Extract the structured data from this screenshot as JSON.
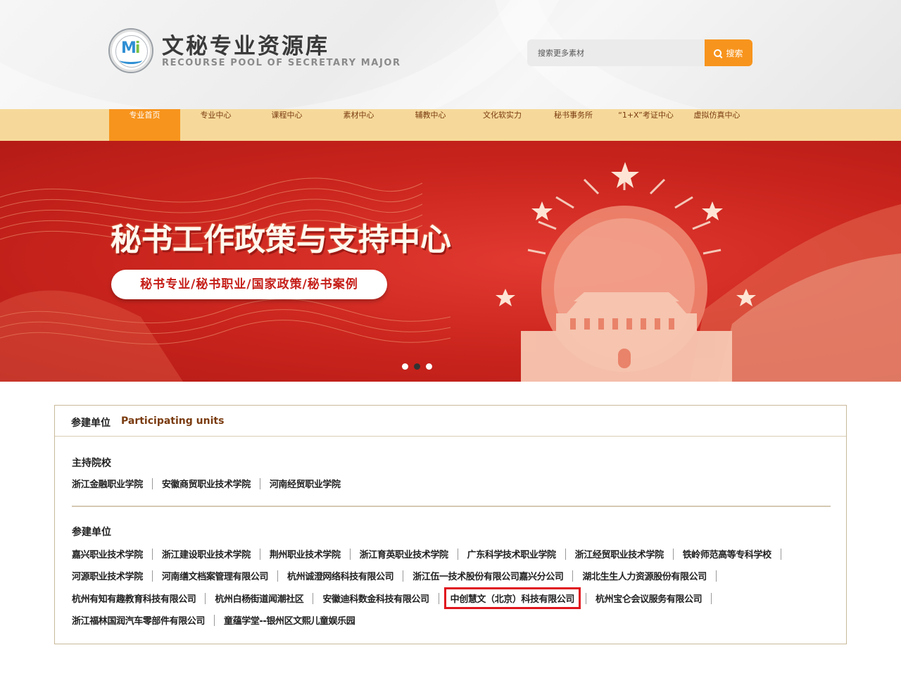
{
  "header": {
    "brand_title": "文秘专业资源库",
    "brand_subtitle": "RECOURSE POOL OF SECRETARY MAJOR",
    "search_placeholder": "搜索更多素材",
    "search_button": "搜索"
  },
  "nav": {
    "items": [
      {
        "label": "专业首页"
      },
      {
        "label": "专业中心"
      },
      {
        "label": "课程中心"
      },
      {
        "label": "素材中心"
      },
      {
        "label": "辅教中心"
      },
      {
        "label": "文化软实力"
      },
      {
        "label": "秘书事务所"
      },
      {
        "label": "“1+X”考证中心"
      },
      {
        "label": "虚拟仿真中心"
      }
    ],
    "active_index": 0
  },
  "banner": {
    "title": "秘书工作政策与支持中心",
    "subtitle": "秘书专业/秘书职业/国家政策/秘书案例",
    "dots": 3,
    "active_dot": 1
  },
  "participants": {
    "heading_cn": "参建单位",
    "heading_en": "Participating units",
    "host_title": "主持院校",
    "hosts": [
      "浙江金融职业学院",
      "安徽商贸职业技术学院",
      "河南经贸职业学院"
    ],
    "members_title": "参建单位",
    "rows": [
      [
        "嘉兴职业技术学院",
        "浙江建设职业技术学院",
        "荆州职业技术学院",
        "浙江育英职业技术学院",
        "广东科学技术职业学院",
        "浙江经贸职业技术学院",
        "铁岭师范高等专科学校"
      ],
      [
        "河源职业技术学院",
        "河南缮文档案管理有限公司",
        "杭州诚澄网络科技有限公司",
        "浙江伍一技术股份有限公司嘉兴分公司",
        "湖北生生人力资源股份有限公司"
      ],
      [
        "杭州有知有趣教育科技有限公司",
        "杭州白杨街道闻潮社区",
        "安徽迪科数金科技有限公司",
        "中创慧文（北京）科技有限公司",
        "杭州宝仑会议服务有限公司"
      ],
      [
        "浙江福林国润汽车零部件有限公司",
        "童蕴学堂--银州区文熙儿童娱乐园"
      ]
    ],
    "highlighted": "中创慧文（北京）科技有限公司"
  },
  "colors": {
    "accent_orange": "#f7941d",
    "nav_bg": "#f6d99a",
    "banner_red": "#c9241d",
    "highlight_red": "#e0161e"
  }
}
